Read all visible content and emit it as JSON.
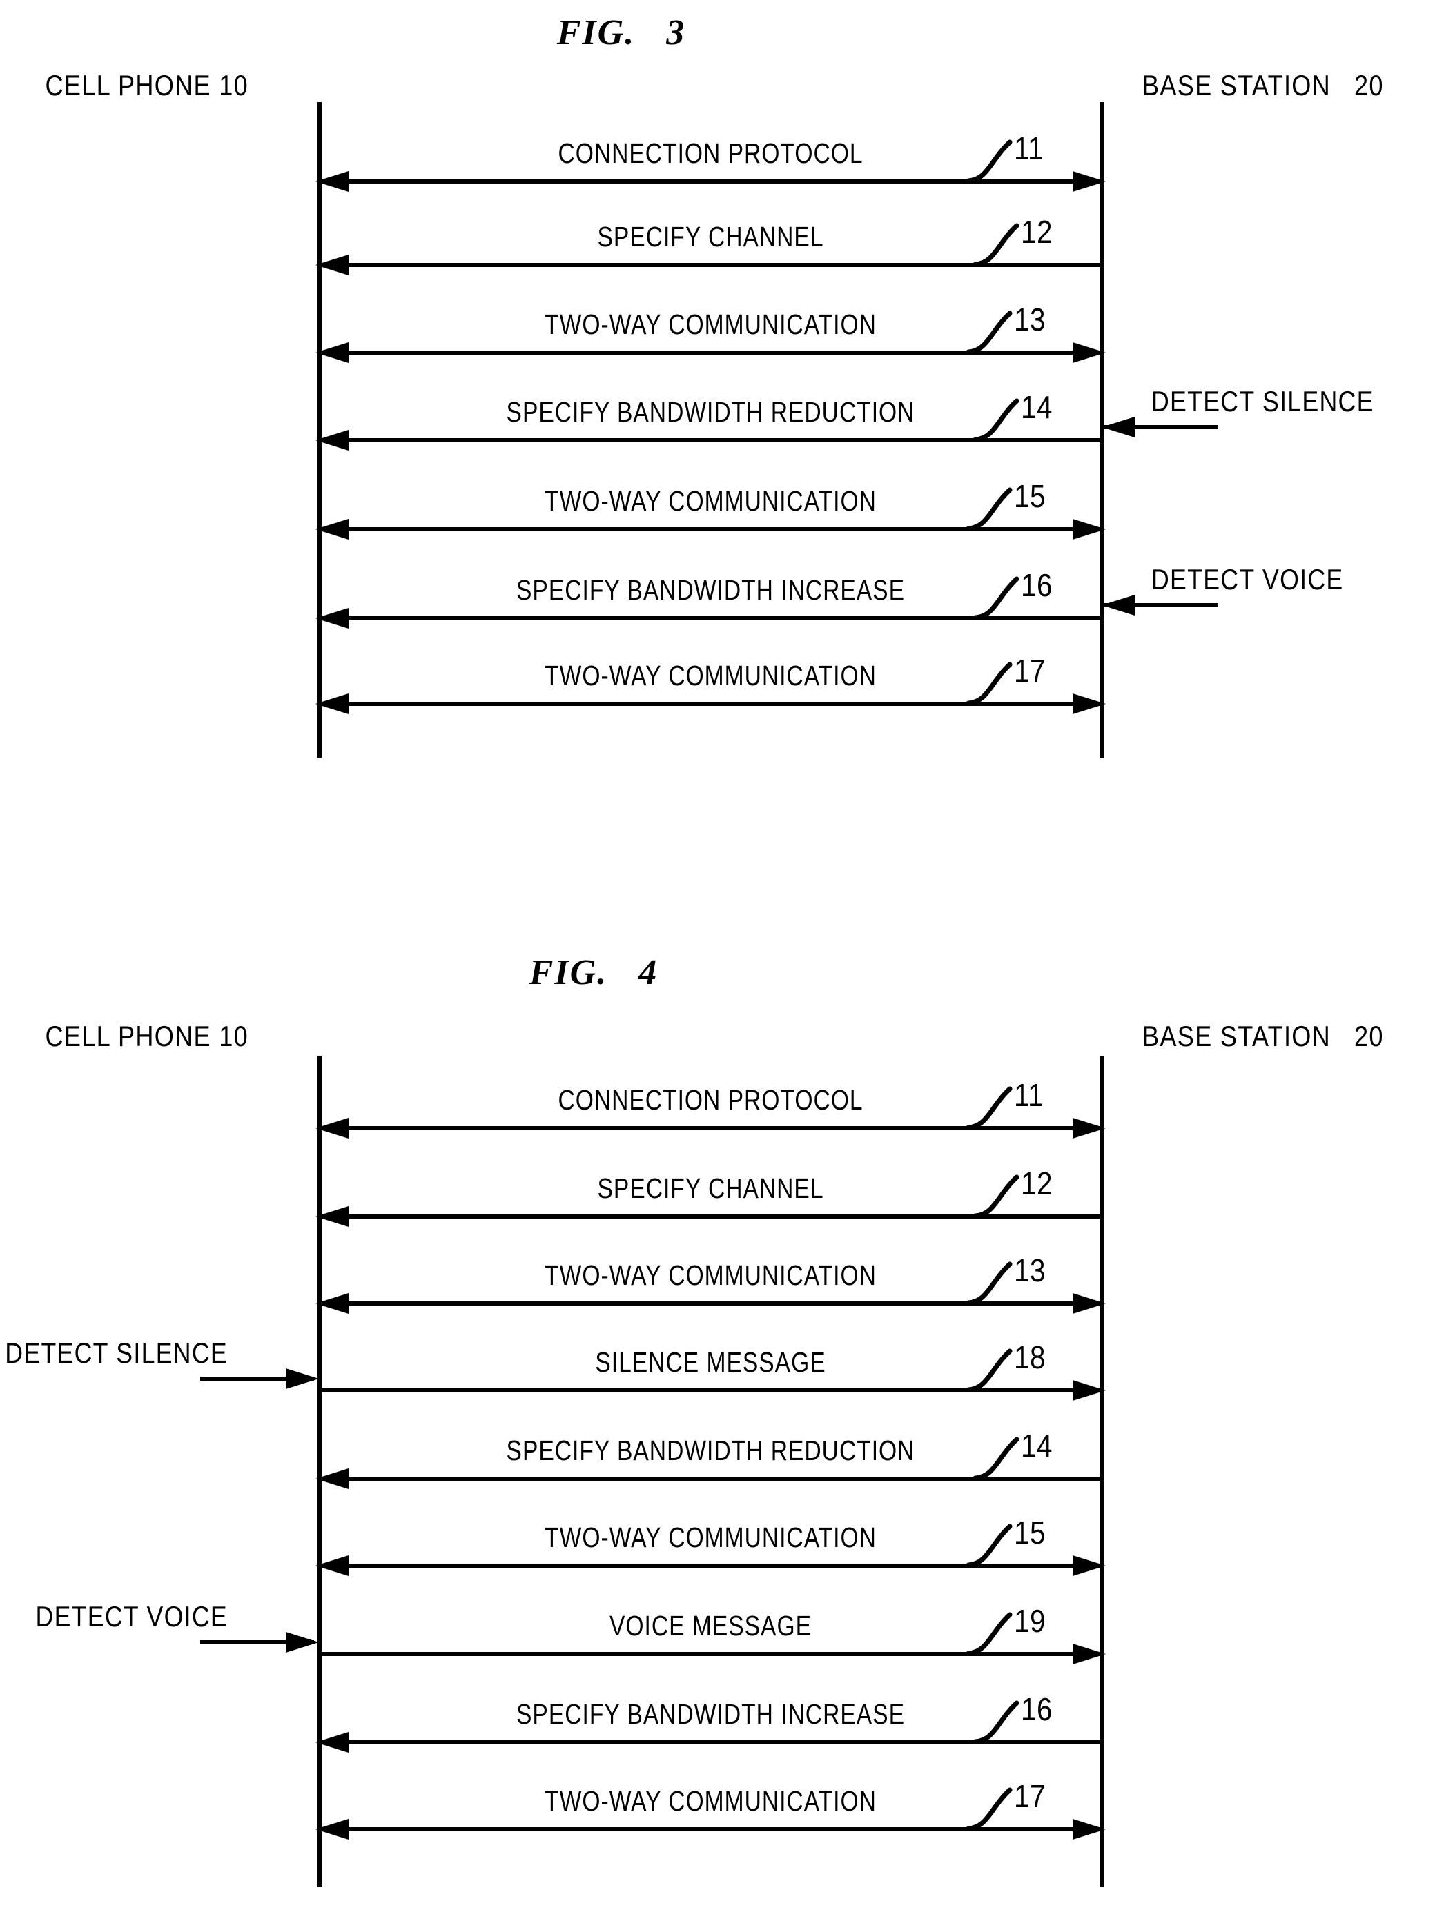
{
  "document": {
    "type": "patent-drawing-sheet",
    "background_color": "#ffffff",
    "ink_color": "#000000"
  },
  "figures": [
    {
      "id": "fig-3",
      "title": "FIG.   3",
      "actors": {
        "left": "CELL PHONE 10",
        "right": "BASE STATION   20"
      },
      "messages": [
        {
          "ref": "11",
          "label": "CONNECTION PROTOCOL",
          "direction": "both"
        },
        {
          "ref": "12",
          "label": "SPECIFY CHANNEL",
          "direction": "left"
        },
        {
          "ref": "13",
          "label": "TWO-WAY COMMUNICATION",
          "direction": "both"
        },
        {
          "ref": "14",
          "label": "SPECIFY BANDWIDTH REDUCTION",
          "direction": "left"
        },
        {
          "ref": "15",
          "label": "TWO-WAY COMMUNICATION",
          "direction": "both"
        },
        {
          "ref": "16",
          "label": "SPECIFY BANDWIDTH INCREASE",
          "direction": "left"
        },
        {
          "ref": "17",
          "label": "TWO-WAY COMMUNICATION",
          "direction": "both"
        }
      ],
      "annotations": [
        {
          "label": "DETECT SILENCE",
          "side": "right",
          "points_to": "base-station",
          "at_message_ref": "14"
        },
        {
          "label": "DETECT VOICE",
          "side": "right",
          "points_to": "base-station",
          "at_message_ref": "16"
        }
      ]
    },
    {
      "id": "fig-4",
      "title": "FIG.   4",
      "actors": {
        "left": "CELL PHONE 10",
        "right": "BASE STATION   20"
      },
      "messages": [
        {
          "ref": "11",
          "label": "CONNECTION PROTOCOL",
          "direction": "both"
        },
        {
          "ref": "12",
          "label": "SPECIFY CHANNEL",
          "direction": "left"
        },
        {
          "ref": "13",
          "label": "TWO-WAY COMMUNICATION",
          "direction": "both"
        },
        {
          "ref": "18",
          "label": "SILENCE MESSAGE",
          "direction": "right"
        },
        {
          "ref": "14",
          "label": "SPECIFY BANDWIDTH REDUCTION",
          "direction": "left"
        },
        {
          "ref": "15",
          "label": "TWO-WAY COMMUNICATION",
          "direction": "both"
        },
        {
          "ref": "19",
          "label": "VOICE MESSAGE",
          "direction": "right"
        },
        {
          "ref": "16",
          "label": "SPECIFY BANDWIDTH INCREASE",
          "direction": "left"
        },
        {
          "ref": "17",
          "label": "TWO-WAY COMMUNICATION",
          "direction": "both"
        }
      ],
      "annotations": [
        {
          "label": "DETECT SILENCE",
          "side": "left",
          "points_to": "cell-phone",
          "at_message_ref": "18"
        },
        {
          "label": "DETECT VOICE",
          "side": "left",
          "points_to": "cell-phone",
          "at_message_ref": "19"
        }
      ]
    }
  ]
}
